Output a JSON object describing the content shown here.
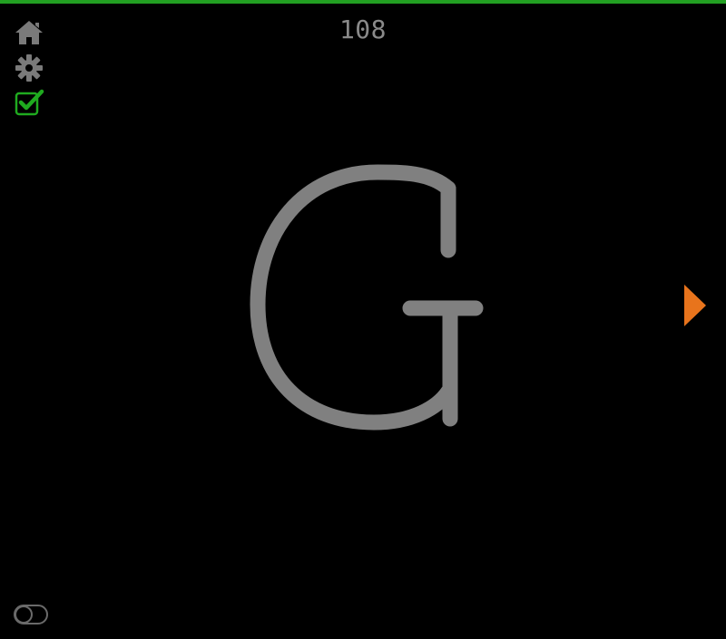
{
  "header": {
    "counter": "108"
  },
  "main": {
    "letter": "G"
  },
  "sidebar": {
    "icons": [
      "home-icon",
      "gear-icon",
      "checkbox-checked-icon"
    ]
  },
  "nav": {
    "next_icon": "triangle-right-icon"
  },
  "footer": {
    "toggle_icon": "toggle-off-icon"
  },
  "colors": {
    "background": "#000000",
    "top_bar": "#22a022",
    "icon_gray": "#7a7a7a",
    "check_green": "#1faa1f",
    "glyph_gray": "#808080",
    "next_orange": "#e8741c",
    "counter_gray": "#8a8a8a"
  }
}
